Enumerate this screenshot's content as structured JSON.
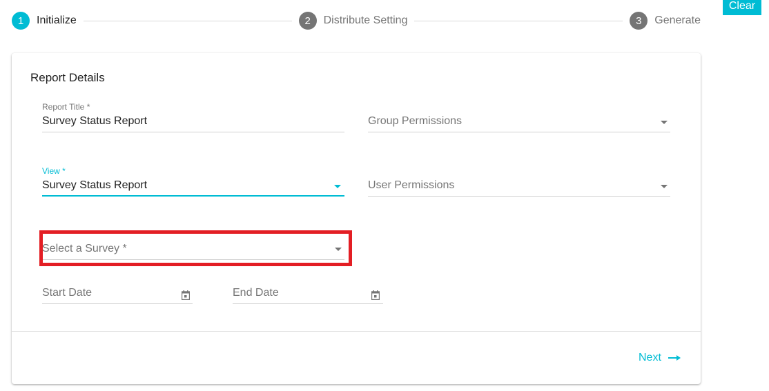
{
  "stepper": {
    "steps": [
      {
        "number": "1",
        "label": "Initialize",
        "state": "active"
      },
      {
        "number": "2",
        "label": "Distribute Setting",
        "state": "inactive"
      },
      {
        "number": "3",
        "label": "Generate",
        "state": "inactive"
      }
    ]
  },
  "toolbar": {
    "clear_label": "Clear"
  },
  "card": {
    "title": "Report Details",
    "fields": {
      "report_title": {
        "label": "Report Title *",
        "value": "Survey Status Report"
      },
      "group_permissions": {
        "placeholder": "Group Permissions"
      },
      "view": {
        "label": "View *",
        "value": "Survey Status Report"
      },
      "user_permissions": {
        "placeholder": "User Permissions"
      },
      "survey": {
        "placeholder": "Select a Survey *"
      },
      "start_date": {
        "placeholder": "Start Date"
      },
      "end_date": {
        "placeholder": "End Date"
      }
    },
    "next_label": "Next"
  },
  "colors": {
    "accent": "#00bcd4",
    "inactive_step": "#757575",
    "highlight": "#e31e24"
  }
}
